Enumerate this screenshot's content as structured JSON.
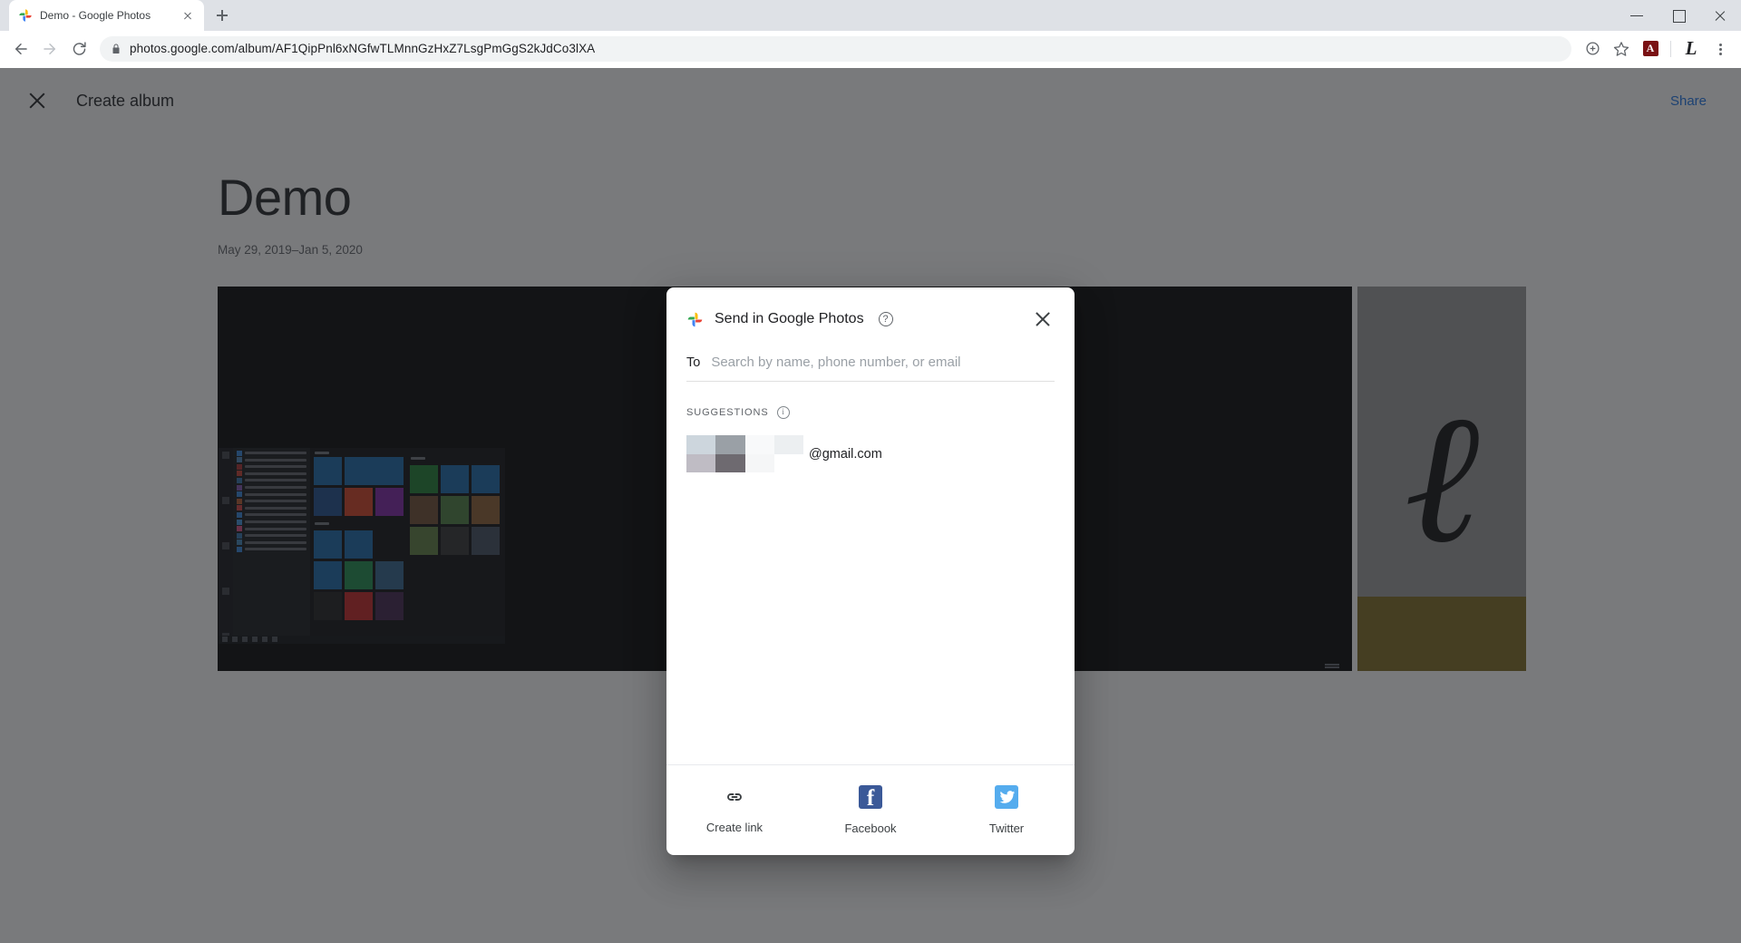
{
  "browser": {
    "tab": {
      "title": "Demo - Google Photos",
      "favicon_name": "google-photos-favicon",
      "close_name": "tab-close-icon"
    },
    "new_tab_label": "+",
    "nav": {
      "back": "back-icon",
      "forward": "forward-icon",
      "reload": "reload-icon"
    },
    "omnibox": {
      "url": "photos.google.com/album/AF1QipPnl6xNGfwTLMnnGzHxZ7LsgPmGgS2kJdCo3lXA",
      "lock_icon": "lock-icon"
    },
    "toolbar_right": {
      "install_icon": "add-circle-icon",
      "bookmark_icon": "star-icon",
      "extension_label": "A",
      "extension_name": "adobe-acrobat-extension-icon",
      "profile_initial": "L",
      "menu_icon": "three-dot-menu-icon"
    },
    "window": {
      "minimize": "minimize-icon",
      "maximize": "maximize-icon",
      "close": "window-close-icon"
    }
  },
  "page": {
    "header": {
      "close_label": "close-icon",
      "title": "Create album",
      "share_label": "Share"
    },
    "album": {
      "title": "Demo",
      "date_range": "May 29, 2019–Jan 5, 2020"
    }
  },
  "dialog": {
    "logo_name": "google-photos-pinwheel-icon",
    "title": "Send in Google Photos",
    "help_label": "?",
    "close_label": "×",
    "to": {
      "label": "To",
      "value": "",
      "placeholder": "Search by name, phone number, or email"
    },
    "suggestions": {
      "label": "SUGGESTIONS",
      "info_label": "i",
      "items": [
        {
          "redacted": true,
          "email": "@gmail.com"
        }
      ]
    },
    "share_options": [
      {
        "label": "Create link",
        "icon": "link-icon"
      },
      {
        "label": "Facebook",
        "icon": "facebook-icon",
        "glyph": "f",
        "color": "#3b5998"
      },
      {
        "label": "Twitter",
        "icon": "twitter-icon",
        "color": "#55acee"
      }
    ]
  },
  "colors": {
    "accent_blue": "#1a73e8",
    "facebook": "#3b5998",
    "twitter": "#55acee",
    "scrim": "rgba(32,33,36,0.6)"
  }
}
